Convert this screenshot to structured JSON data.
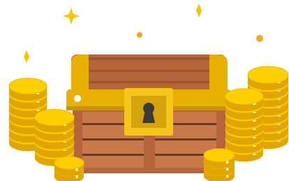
{
  "illustration": {
    "subject": "treasure-chest-with-coin-stacks",
    "icons": [
      "treasure-chest-icon",
      "keyhole-icon",
      "coin-stack-icon",
      "sparkle-icon"
    ],
    "colors": {
      "gold": "#FFD000",
      "gold_shadow": "#F2B705",
      "gold_dark": "#E0A500",
      "gold_edge": "#F5BE00",
      "highlight": "#FFF4B0",
      "wood": "#B5653A",
      "wood_plank": "#9C5532",
      "wood_dark": "#6E3A1E",
      "wood_panel": "#C8794A",
      "band": "#E8B000",
      "band_dark": "#C99400",
      "lock_plate": "#F5C518",
      "lock_inner": "#D4A30E",
      "keyhole": "#3A3A3A",
      "sparkle": "#F7C400",
      "dot": "#F5A623",
      "background": "#FFFFFF"
    }
  }
}
